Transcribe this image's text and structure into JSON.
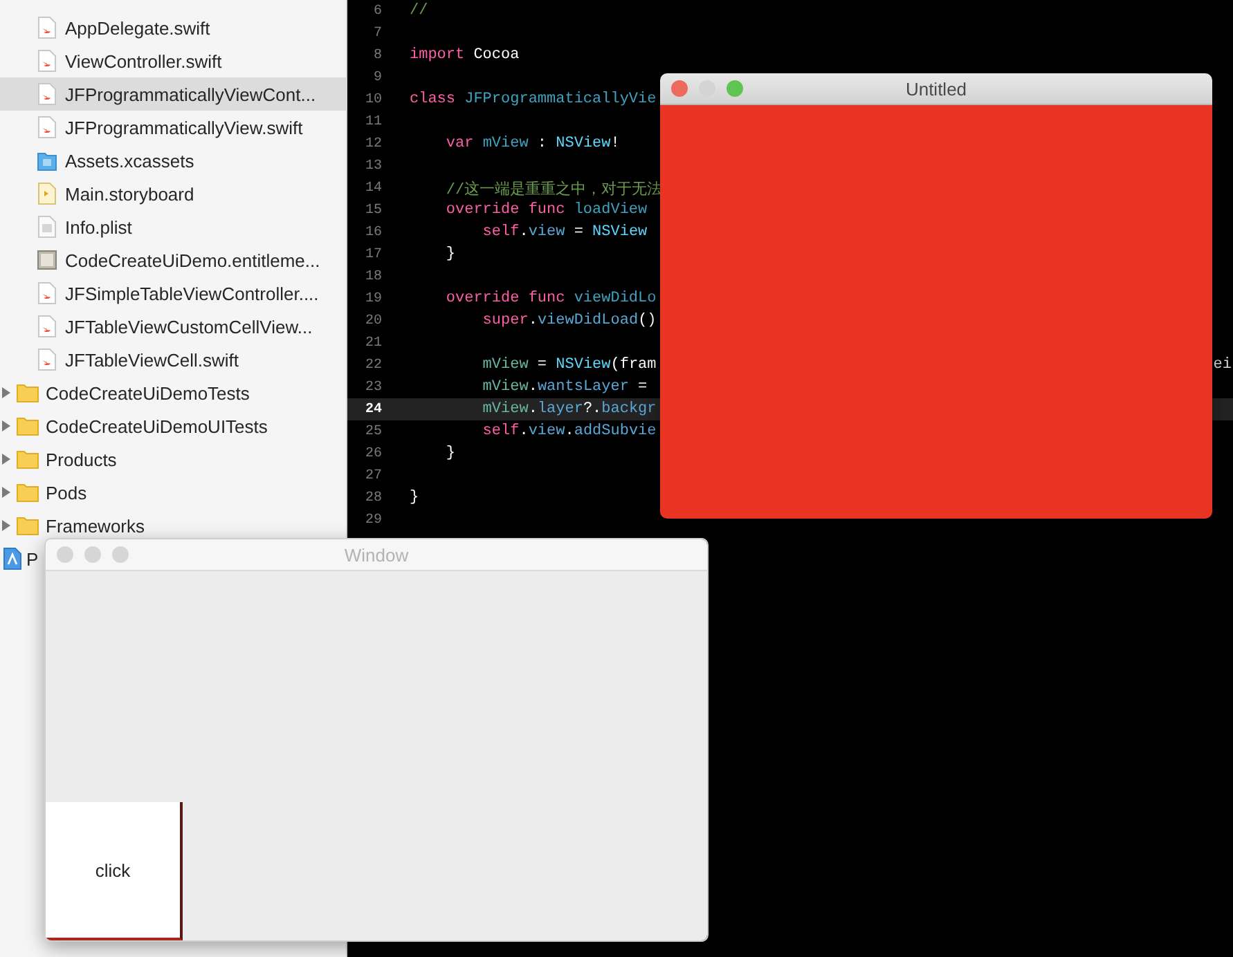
{
  "navigator": {
    "files": [
      {
        "kind": "swift",
        "label": "AppDelegate.swift",
        "selected": false
      },
      {
        "kind": "swift",
        "label": "ViewController.swift",
        "selected": false
      },
      {
        "kind": "swift",
        "label": "JFProgrammaticallyViewCont...",
        "selected": true
      },
      {
        "kind": "swift",
        "label": "JFProgrammaticallyView.swift",
        "selected": false
      },
      {
        "kind": "assets",
        "label": "Assets.xcassets",
        "selected": false
      },
      {
        "kind": "storyboard",
        "label": "Main.storyboard",
        "selected": false
      },
      {
        "kind": "plist",
        "label": "Info.plist",
        "selected": false
      },
      {
        "kind": "entitlements",
        "label": "CodeCreateUiDemo.entitleme...",
        "selected": false
      },
      {
        "kind": "swift",
        "label": "JFSimpleTableViewController....",
        "selected": false
      },
      {
        "kind": "swift",
        "label": "JFTableViewCustomCellView...",
        "selected": false
      },
      {
        "kind": "swift",
        "label": "JFTableViewCell.swift",
        "selected": false
      }
    ],
    "groups": [
      {
        "label": "CodeCreateUiDemoTests",
        "expanded": false
      },
      {
        "label": "CodeCreateUiDemoUITests",
        "expanded": false
      },
      {
        "label": "Products",
        "expanded": false
      },
      {
        "label": "Pods",
        "expanded": false
      },
      {
        "label": "Frameworks",
        "expanded": false
      }
    ],
    "project": {
      "label": "P"
    }
  },
  "editor": {
    "lines": [
      {
        "number": "6",
        "current": false,
        "tokens": [
          {
            "kind": "comment",
            "text": "//"
          }
        ]
      },
      {
        "number": "7",
        "current": false
      },
      {
        "number": "8",
        "current": false,
        "tokens": [
          {
            "kind": "kw",
            "text": "import"
          },
          {
            "kind": "plain",
            "text": " Cocoa"
          }
        ]
      },
      {
        "number": "9",
        "current": false
      },
      {
        "number": "10",
        "current": false,
        "tokens": [
          {
            "kind": "kw",
            "text": "class "
          },
          {
            "kind": "decl",
            "text": "JFProgrammaticallyVie"
          }
        ]
      },
      {
        "number": "11",
        "current": false
      },
      {
        "number": "12",
        "current": false,
        "tokens": [
          {
            "kind": "kw",
            "text": "    var "
          },
          {
            "kind": "decl",
            "text": "mView"
          },
          {
            "kind": "plain",
            "text": " : "
          },
          {
            "kind": "type",
            "text": "NSView"
          },
          {
            "kind": "plain",
            "text": "!"
          }
        ]
      },
      {
        "number": "13",
        "current": false
      },
      {
        "number": "14",
        "current": false,
        "tokens": [
          {
            "kind": "comment",
            "text": "    //这一端是重重之中，对于无法"
          }
        ]
      },
      {
        "number": "15",
        "current": false,
        "tokens": [
          {
            "kind": "kw",
            "text": "    override func "
          },
          {
            "kind": "decl",
            "text": "loadView"
          }
        ]
      },
      {
        "number": "16",
        "current": false,
        "tokens": [
          {
            "kind": "kw",
            "text": "        self"
          },
          {
            "kind": "plain",
            "text": "."
          },
          {
            "kind": "member",
            "text": "view"
          },
          {
            "kind": "plain",
            "text": " = "
          },
          {
            "kind": "type",
            "text": "NSView"
          }
        ]
      },
      {
        "number": "17",
        "current": false,
        "tokens": [
          {
            "kind": "plain",
            "text": "    }"
          }
        ]
      },
      {
        "number": "18",
        "current": false
      },
      {
        "number": "19",
        "current": false,
        "tokens": [
          {
            "kind": "kw",
            "text": "    override func "
          },
          {
            "kind": "decl",
            "text": "viewDidLo"
          }
        ]
      },
      {
        "number": "20",
        "current": false,
        "tokens": [
          {
            "kind": "kw",
            "text": "        super"
          },
          {
            "kind": "plain",
            "text": "."
          },
          {
            "kind": "member",
            "text": "viewDidLoad"
          },
          {
            "kind": "plain",
            "text": "()"
          }
        ]
      },
      {
        "number": "21",
        "current": false
      },
      {
        "number": "22",
        "current": false,
        "tokens": [
          {
            "kind": "ident",
            "text": "        mView"
          },
          {
            "kind": "plain",
            "text": " = "
          },
          {
            "kind": "type",
            "text": "NSView"
          },
          {
            "kind": "plain",
            "text": "(fram"
          }
        ],
        "tail": "ei"
      },
      {
        "number": "23",
        "current": false,
        "tokens": [
          {
            "kind": "ident",
            "text": "        mView"
          },
          {
            "kind": "plain",
            "text": "."
          },
          {
            "kind": "member",
            "text": "wantsLayer"
          },
          {
            "kind": "plain",
            "text": " ="
          }
        ]
      },
      {
        "number": "24",
        "current": true,
        "tokens": [
          {
            "kind": "ident",
            "text": "        mView"
          },
          {
            "kind": "plain",
            "text": "."
          },
          {
            "kind": "member",
            "text": "layer"
          },
          {
            "kind": "plain",
            "text": "?."
          },
          {
            "kind": "member",
            "text": "backgr"
          }
        ]
      },
      {
        "number": "25",
        "current": false,
        "tokens": [
          {
            "kind": "kw",
            "text": "        self"
          },
          {
            "kind": "plain",
            "text": "."
          },
          {
            "kind": "member",
            "text": "view"
          },
          {
            "kind": "plain",
            "text": "."
          },
          {
            "kind": "member",
            "text": "addSubvie"
          }
        ]
      },
      {
        "number": "26",
        "current": false,
        "tokens": [
          {
            "kind": "plain",
            "text": "    }"
          }
        ]
      },
      {
        "number": "27",
        "current": false
      },
      {
        "number": "28",
        "current": false,
        "tokens": [
          {
            "kind": "plain",
            "text": "}"
          }
        ]
      },
      {
        "number": "29",
        "current": false
      }
    ]
  },
  "windows": [
    {
      "title": "Untitled",
      "active": true,
      "kind": "red"
    },
    {
      "title": "Window",
      "active": false,
      "kind": "button",
      "button": {
        "label": "click"
      }
    }
  ]
}
